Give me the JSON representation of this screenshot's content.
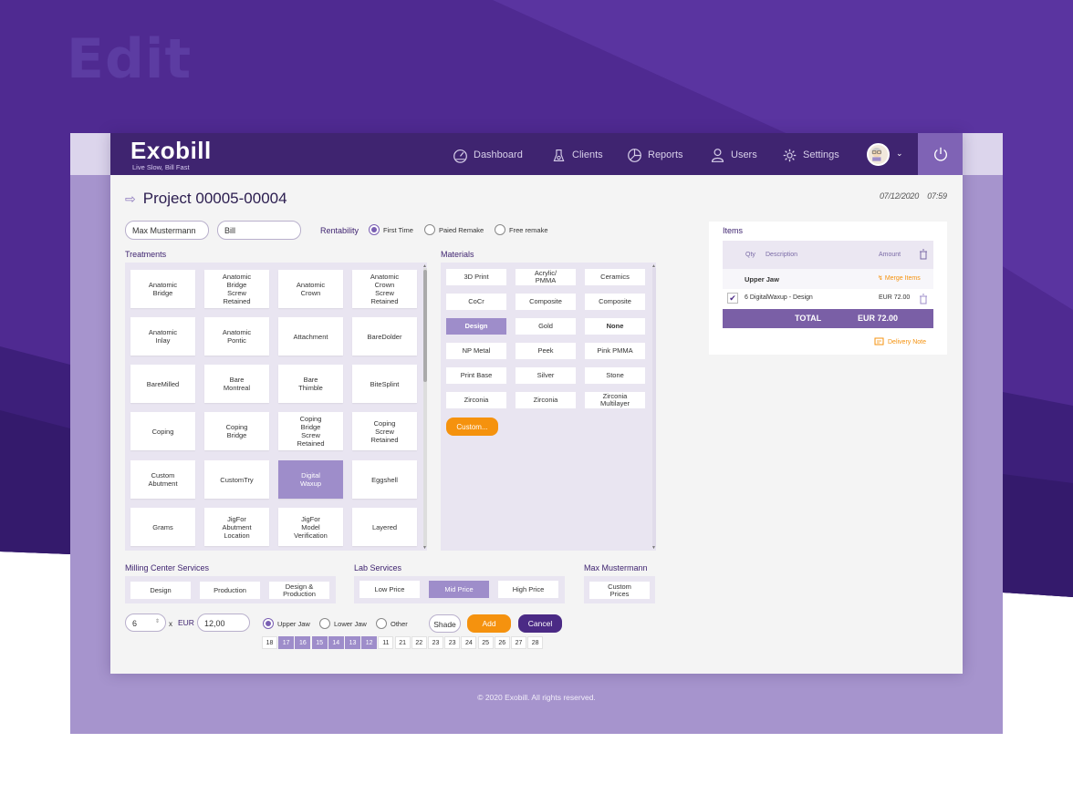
{
  "page": {
    "heading": "Edit"
  },
  "brand": {
    "name": "Exobill",
    "tagline": "Live Slow, Bill Fast"
  },
  "nav": {
    "items": [
      {
        "label": "Dashboard",
        "icon": "dashboard-icon"
      },
      {
        "label": "Clients",
        "icon": "clients-icon"
      },
      {
        "label": "Reports",
        "icon": "reports-icon"
      },
      {
        "label": "Users",
        "icon": "user-icon"
      },
      {
        "label": "Settings",
        "icon": "gear-icon"
      }
    ],
    "power_icon": "power-icon"
  },
  "project": {
    "title": "Project 00005-00004",
    "date": "07/12/2020",
    "time": "07:59"
  },
  "form": {
    "client": "Max Mustermann",
    "type": "Bill",
    "rentability_label": "Rentability",
    "rentability_options": [
      "First Time",
      "Paied Remake",
      "Free remake"
    ],
    "rentability_selected": "First Time"
  },
  "treatments": {
    "label": "Treatments",
    "items": [
      "Anatomic\nBridge",
      "Anatomic\nBridge\nScrew\nRetained",
      "Anatomic\nCrown",
      "Anatomic\nCrown\nScrew\nRetained",
      "Anatomic\nInlay",
      "Anatomic\nPontic",
      "Attachment",
      "BareDolder",
      "BareMilled",
      "Bare\nMontreal",
      "Bare\nThimble",
      "BiteSplint",
      "Coping",
      "Coping\nBridge",
      "Coping\nBridge\nScrew\nRetained",
      "Coping\nScrew\nRetained",
      "Custom\nAbutment",
      "CustomTry",
      "Digital\nWaxup",
      "Eggshell",
      "Grams",
      "JigFor\nAbutment\nLocation",
      "JigFor\nModel\nVerification",
      "Layered"
    ],
    "selected": "Digital\nWaxup"
  },
  "materials": {
    "label": "Materials",
    "items": [
      "3D Print",
      "Acrylic/\nPMMA",
      "Ceramics",
      "CoCr",
      "Composite",
      "Composite",
      "Design",
      "Gold",
      "None",
      "NP Metal",
      "Peek",
      "Pink PMMA",
      "Print Base",
      "Silver",
      "Stone",
      "Zirconia",
      "Zirconia",
      "Zirconia\nMultilayer"
    ],
    "selected": "Design",
    "custom_button": "Custom..."
  },
  "milling": {
    "label": "Milling Center Services",
    "items": [
      "Design",
      "Production",
      "Design &\nProduction"
    ]
  },
  "lab": {
    "label": "Lab Services",
    "items": [
      "Low Price",
      "Mid Price",
      "High Price"
    ],
    "selected": "Mid Price"
  },
  "client_prices": {
    "label": "Max Mustermann",
    "button": "Custom\nPrices"
  },
  "order": {
    "quantity": "6",
    "times": "x",
    "currency": "EUR",
    "price": "12,00",
    "jaw_options": [
      "Upper Jaw",
      "Lower Jaw",
      "Other"
    ],
    "jaw_selected": "Upper Jaw",
    "shade_label": "Shade",
    "add_label": "Add",
    "cancel_label": "Cancel"
  },
  "teeth": {
    "numbers": [
      "18",
      "17",
      "16",
      "15",
      "14",
      "13",
      "12",
      "11",
      "21",
      "22",
      "23",
      "23",
      "24",
      "25",
      "26",
      "27",
      "28"
    ],
    "selected": [
      "17",
      "16",
      "15",
      "14",
      "13",
      "12"
    ]
  },
  "items_panel": {
    "title": "Items",
    "columns": [
      "Qty",
      "Description",
      "Amount"
    ],
    "group": "Upper Jaw",
    "merge_label": "Merge Items",
    "rows": [
      {
        "description": "6 DigitalWaxup -  Design",
        "amount": "EUR 72.00"
      }
    ],
    "total_label": "TOTAL",
    "total_value": "EUR 72.00",
    "delivery_note": "Delivery Note"
  },
  "footer": {
    "text": "© 2020 Exobill. All rights reserved."
  },
  "colors": {
    "primary": "#3f2470",
    "accent": "#9e8dca",
    "orange": "#f5920e",
    "background": "#4f2a91"
  }
}
